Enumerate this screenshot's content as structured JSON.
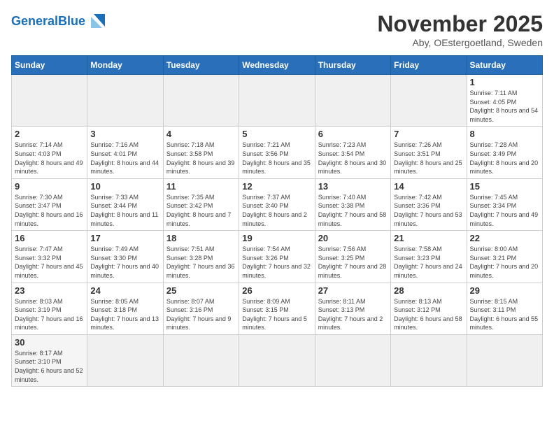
{
  "header": {
    "logo_general": "General",
    "logo_blue": "Blue",
    "month_title": "November 2025",
    "location": "Aby, OEstergoetland, Sweden"
  },
  "weekdays": [
    "Sunday",
    "Monday",
    "Tuesday",
    "Wednesday",
    "Thursday",
    "Friday",
    "Saturday"
  ],
  "weeks": [
    [
      {
        "day": "",
        "empty": true
      },
      {
        "day": "",
        "empty": true
      },
      {
        "day": "",
        "empty": true
      },
      {
        "day": "",
        "empty": true
      },
      {
        "day": "",
        "empty": true
      },
      {
        "day": "",
        "empty": true
      },
      {
        "day": "1",
        "sunrise": "Sunrise: 7:11 AM",
        "sunset": "Sunset: 4:05 PM",
        "daylight": "Daylight: 8 hours and 54 minutes."
      }
    ],
    [
      {
        "day": "2",
        "sunrise": "Sunrise: 7:14 AM",
        "sunset": "Sunset: 4:03 PM",
        "daylight": "Daylight: 8 hours and 49 minutes."
      },
      {
        "day": "3",
        "sunrise": "Sunrise: 7:16 AM",
        "sunset": "Sunset: 4:01 PM",
        "daylight": "Daylight: 8 hours and 44 minutes."
      },
      {
        "day": "4",
        "sunrise": "Sunrise: 7:18 AM",
        "sunset": "Sunset: 3:58 PM",
        "daylight": "Daylight: 8 hours and 39 minutes."
      },
      {
        "day": "5",
        "sunrise": "Sunrise: 7:21 AM",
        "sunset": "Sunset: 3:56 PM",
        "daylight": "Daylight: 8 hours and 35 minutes."
      },
      {
        "day": "6",
        "sunrise": "Sunrise: 7:23 AM",
        "sunset": "Sunset: 3:54 PM",
        "daylight": "Daylight: 8 hours and 30 minutes."
      },
      {
        "day": "7",
        "sunrise": "Sunrise: 7:26 AM",
        "sunset": "Sunset: 3:51 PM",
        "daylight": "Daylight: 8 hours and 25 minutes."
      },
      {
        "day": "8",
        "sunrise": "Sunrise: 7:28 AM",
        "sunset": "Sunset: 3:49 PM",
        "daylight": "Daylight: 8 hours and 20 minutes."
      }
    ],
    [
      {
        "day": "9",
        "sunrise": "Sunrise: 7:30 AM",
        "sunset": "Sunset: 3:47 PM",
        "daylight": "Daylight: 8 hours and 16 minutes."
      },
      {
        "day": "10",
        "sunrise": "Sunrise: 7:33 AM",
        "sunset": "Sunset: 3:44 PM",
        "daylight": "Daylight: 8 hours and 11 minutes."
      },
      {
        "day": "11",
        "sunrise": "Sunrise: 7:35 AM",
        "sunset": "Sunset: 3:42 PM",
        "daylight": "Daylight: 8 hours and 7 minutes."
      },
      {
        "day": "12",
        "sunrise": "Sunrise: 7:37 AM",
        "sunset": "Sunset: 3:40 PM",
        "daylight": "Daylight: 8 hours and 2 minutes."
      },
      {
        "day": "13",
        "sunrise": "Sunrise: 7:40 AM",
        "sunset": "Sunset: 3:38 PM",
        "daylight": "Daylight: 7 hours and 58 minutes."
      },
      {
        "day": "14",
        "sunrise": "Sunrise: 7:42 AM",
        "sunset": "Sunset: 3:36 PM",
        "daylight": "Daylight: 7 hours and 53 minutes."
      },
      {
        "day": "15",
        "sunrise": "Sunrise: 7:45 AM",
        "sunset": "Sunset: 3:34 PM",
        "daylight": "Daylight: 7 hours and 49 minutes."
      }
    ],
    [
      {
        "day": "16",
        "sunrise": "Sunrise: 7:47 AM",
        "sunset": "Sunset: 3:32 PM",
        "daylight": "Daylight: 7 hours and 45 minutes."
      },
      {
        "day": "17",
        "sunrise": "Sunrise: 7:49 AM",
        "sunset": "Sunset: 3:30 PM",
        "daylight": "Daylight: 7 hours and 40 minutes."
      },
      {
        "day": "18",
        "sunrise": "Sunrise: 7:51 AM",
        "sunset": "Sunset: 3:28 PM",
        "daylight": "Daylight: 7 hours and 36 minutes."
      },
      {
        "day": "19",
        "sunrise": "Sunrise: 7:54 AM",
        "sunset": "Sunset: 3:26 PM",
        "daylight": "Daylight: 7 hours and 32 minutes."
      },
      {
        "day": "20",
        "sunrise": "Sunrise: 7:56 AM",
        "sunset": "Sunset: 3:25 PM",
        "daylight": "Daylight: 7 hours and 28 minutes."
      },
      {
        "day": "21",
        "sunrise": "Sunrise: 7:58 AM",
        "sunset": "Sunset: 3:23 PM",
        "daylight": "Daylight: 7 hours and 24 minutes."
      },
      {
        "day": "22",
        "sunrise": "Sunrise: 8:00 AM",
        "sunset": "Sunset: 3:21 PM",
        "daylight": "Daylight: 7 hours and 20 minutes."
      }
    ],
    [
      {
        "day": "23",
        "sunrise": "Sunrise: 8:03 AM",
        "sunset": "Sunset: 3:19 PM",
        "daylight": "Daylight: 7 hours and 16 minutes."
      },
      {
        "day": "24",
        "sunrise": "Sunrise: 8:05 AM",
        "sunset": "Sunset: 3:18 PM",
        "daylight": "Daylight: 7 hours and 13 minutes."
      },
      {
        "day": "25",
        "sunrise": "Sunrise: 8:07 AM",
        "sunset": "Sunset: 3:16 PM",
        "daylight": "Daylight: 7 hours and 9 minutes."
      },
      {
        "day": "26",
        "sunrise": "Sunrise: 8:09 AM",
        "sunset": "Sunset: 3:15 PM",
        "daylight": "Daylight: 7 hours and 5 minutes."
      },
      {
        "day": "27",
        "sunrise": "Sunrise: 8:11 AM",
        "sunset": "Sunset: 3:13 PM",
        "daylight": "Daylight: 7 hours and 2 minutes."
      },
      {
        "day": "28",
        "sunrise": "Sunrise: 8:13 AM",
        "sunset": "Sunset: 3:12 PM",
        "daylight": "Daylight: 6 hours and 58 minutes."
      },
      {
        "day": "29",
        "sunrise": "Sunrise: 8:15 AM",
        "sunset": "Sunset: 3:11 PM",
        "daylight": "Daylight: 6 hours and 55 minutes."
      }
    ],
    [
      {
        "day": "30",
        "sunrise": "Sunrise: 8:17 AM",
        "sunset": "Sunset: 3:10 PM",
        "daylight": "Daylight: 6 hours and 52 minutes."
      },
      {
        "day": "",
        "empty": true
      },
      {
        "day": "",
        "empty": true
      },
      {
        "day": "",
        "empty": true
      },
      {
        "day": "",
        "empty": true
      },
      {
        "day": "",
        "empty": true
      },
      {
        "day": "",
        "empty": true
      }
    ]
  ]
}
